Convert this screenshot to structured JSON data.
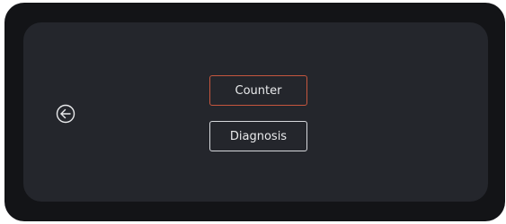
{
  "menu": {
    "buttons": [
      {
        "label": "Counter",
        "state": "selected"
      },
      {
        "label": "Diagnosis",
        "state": "normal"
      }
    ]
  },
  "nav": {
    "back_icon": "back-arrow-icon"
  },
  "colors": {
    "frame": "#131417",
    "screen": "#24262c",
    "selected_border": "#c5563e",
    "normal_border": "#d6d8dc",
    "text": "#e9eaec"
  }
}
